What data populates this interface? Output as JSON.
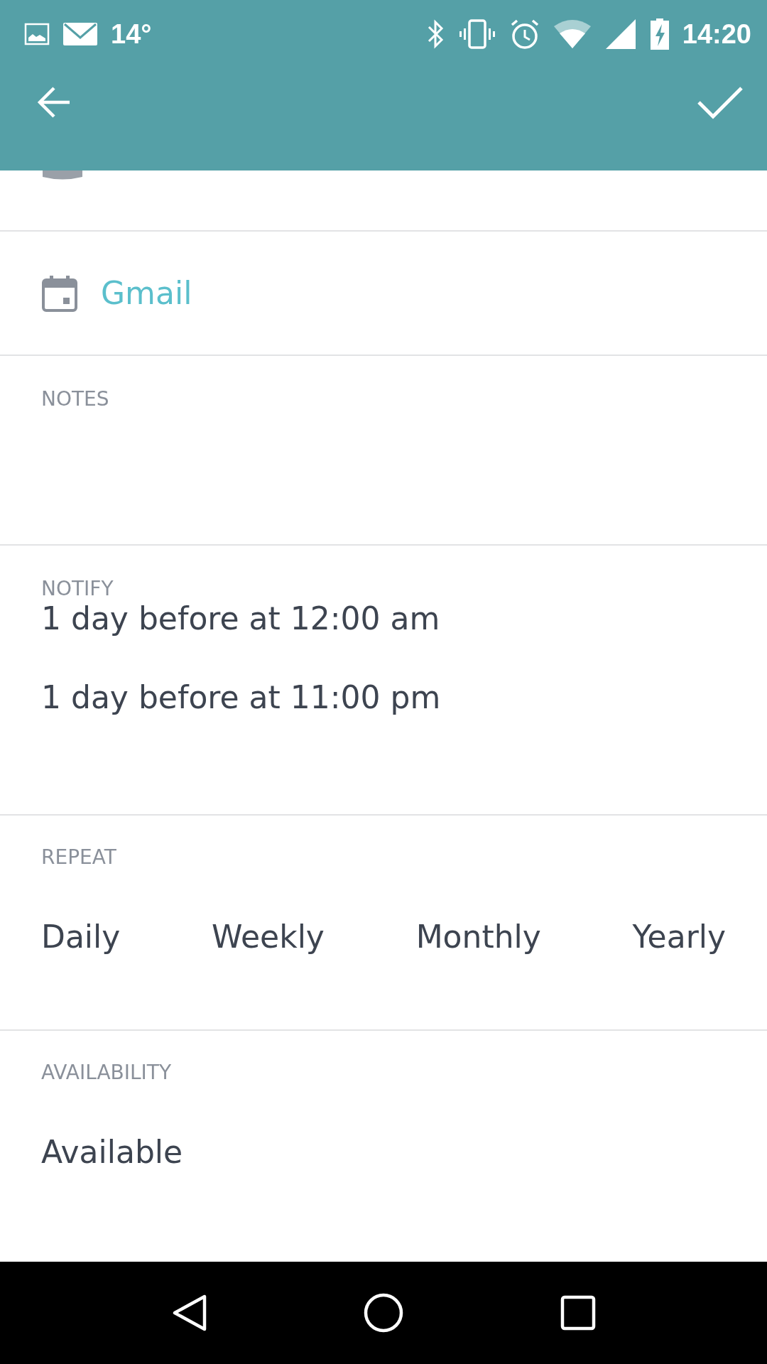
{
  "status_bar": {
    "temperature": "14°",
    "time": "14:20"
  },
  "calendar": {
    "name": "Gmail"
  },
  "notes": {
    "label": "NOTES"
  },
  "notify": {
    "label": "NOTIFY",
    "items": [
      "1 day before at 12:00 am",
      "1 day before at 11:00 pm"
    ]
  },
  "repeat": {
    "label": "REPEAT",
    "options": [
      "Daily",
      "Weekly",
      "Monthly",
      "Yearly"
    ]
  },
  "availability": {
    "label": "AVAILABILITY",
    "value": "Available"
  }
}
